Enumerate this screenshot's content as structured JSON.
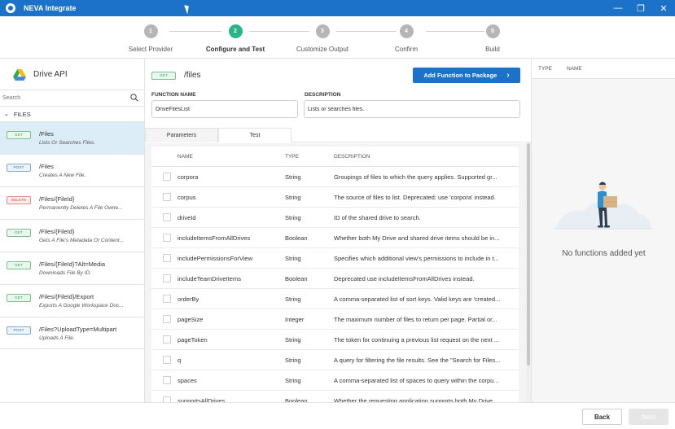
{
  "window": {
    "title": "NEVA Integrate",
    "minimize_glyph": "—",
    "maximize_glyph": "❐",
    "close_glyph": "✕"
  },
  "stepper": {
    "steps": [
      {
        "number": "1",
        "label": "Select Provider",
        "active": false
      },
      {
        "number": "2",
        "label": "Configure and Test",
        "active": true
      },
      {
        "number": "3",
        "label": "Customize Output",
        "active": false
      },
      {
        "number": "4",
        "label": "Confirm",
        "active": false
      },
      {
        "number": "5",
        "label": "Build",
        "active": false
      }
    ]
  },
  "sidebar": {
    "api_name": "Drive API",
    "search_placeholder": "Search",
    "section_label": "FILES",
    "items": [
      {
        "method": "GET",
        "path": "/Files",
        "desc": "Lists Or Searches Files."
      },
      {
        "method": "POST",
        "path": "/Files",
        "desc": "Creates A New File."
      },
      {
        "method": "DELETE",
        "path": "/Files/{FileId}",
        "desc": "Permanently Deletes A File Owne..."
      },
      {
        "method": "GET",
        "path": "/Files/{FileId}",
        "desc": "Gets A File's Metadata Or Content..."
      },
      {
        "method": "GET",
        "path": "/Files/{FileId}?Alt=Media",
        "desc": "Downloads File By ID."
      },
      {
        "method": "GET",
        "path": "/Files/{FileId}/Export",
        "desc": "Exports A Google Workspace Doc..."
      },
      {
        "method": "POST",
        "path": "/Files?UploadType=Multipart",
        "desc": "Uploads A File."
      }
    ]
  },
  "main": {
    "method": "GET",
    "path": "/files",
    "add_button_label": "Add Function to Package",
    "function_name_label": "FUNCTION NAME",
    "function_name_value": "DriveFilesList",
    "description_label": "DESCRIPTION",
    "description_value": "Lists or searches files.",
    "tabs": [
      {
        "label": "Parameters",
        "active": true
      },
      {
        "label": "Test",
        "active": false
      }
    ],
    "table": {
      "headers": {
        "name": "NAME",
        "type": "TYPE",
        "description": "DESCRIPTION"
      },
      "rows": [
        {
          "name": "corpora",
          "type": "String",
          "description": "Groupings of files to which the query applies. Supported gr..."
        },
        {
          "name": "corpus",
          "type": "String",
          "description": "The source of files to list. Deprecated: use 'corpora' instead."
        },
        {
          "name": "driveId",
          "type": "String",
          "description": "ID of the shared drive to search."
        },
        {
          "name": "includeItemsFromAllDrives",
          "type": "Boolean",
          "description": "Whether both My Drive and shared drive items should be in..."
        },
        {
          "name": "includePermissionsForView",
          "type": "String",
          "description": "Specifies which additional view's permissions to include in t..."
        },
        {
          "name": "includeTeamDriveItems",
          "type": "Boolean",
          "description": "Deprecated use includeItemsFromAllDrives instead."
        },
        {
          "name": "orderBy",
          "type": "String",
          "description": "A comma-separated list of sort keys. Valid keys are 'created..."
        },
        {
          "name": "pageSize",
          "type": "Integer",
          "description": "The maximum number of files to return per page. Partial or..."
        },
        {
          "name": "pageToken",
          "type": "String",
          "description": "The token for continuing a previous list request on the next ..."
        },
        {
          "name": "q",
          "type": "String",
          "description": "A query for filtering the file results. See the \"Search for Files..."
        },
        {
          "name": "spaces",
          "type": "String",
          "description": "A comma-separated list of spaces to query within the corpu..."
        },
        {
          "name": "supportsAllDrives",
          "type": "Boolean",
          "description": "Whether the requesting application supports both My Drive..."
        }
      ]
    }
  },
  "right_panel": {
    "type_header": "TYPE",
    "name_header": "NAME",
    "empty_text": "No functions added yet"
  },
  "footer": {
    "back_label": "Back",
    "next_label": "Next"
  },
  "colors": {
    "brand_blue": "#1b72c8",
    "active_step": "#2bb38a",
    "inactive_step": "#b6b6b6",
    "selected_row": "#dcedf8"
  }
}
